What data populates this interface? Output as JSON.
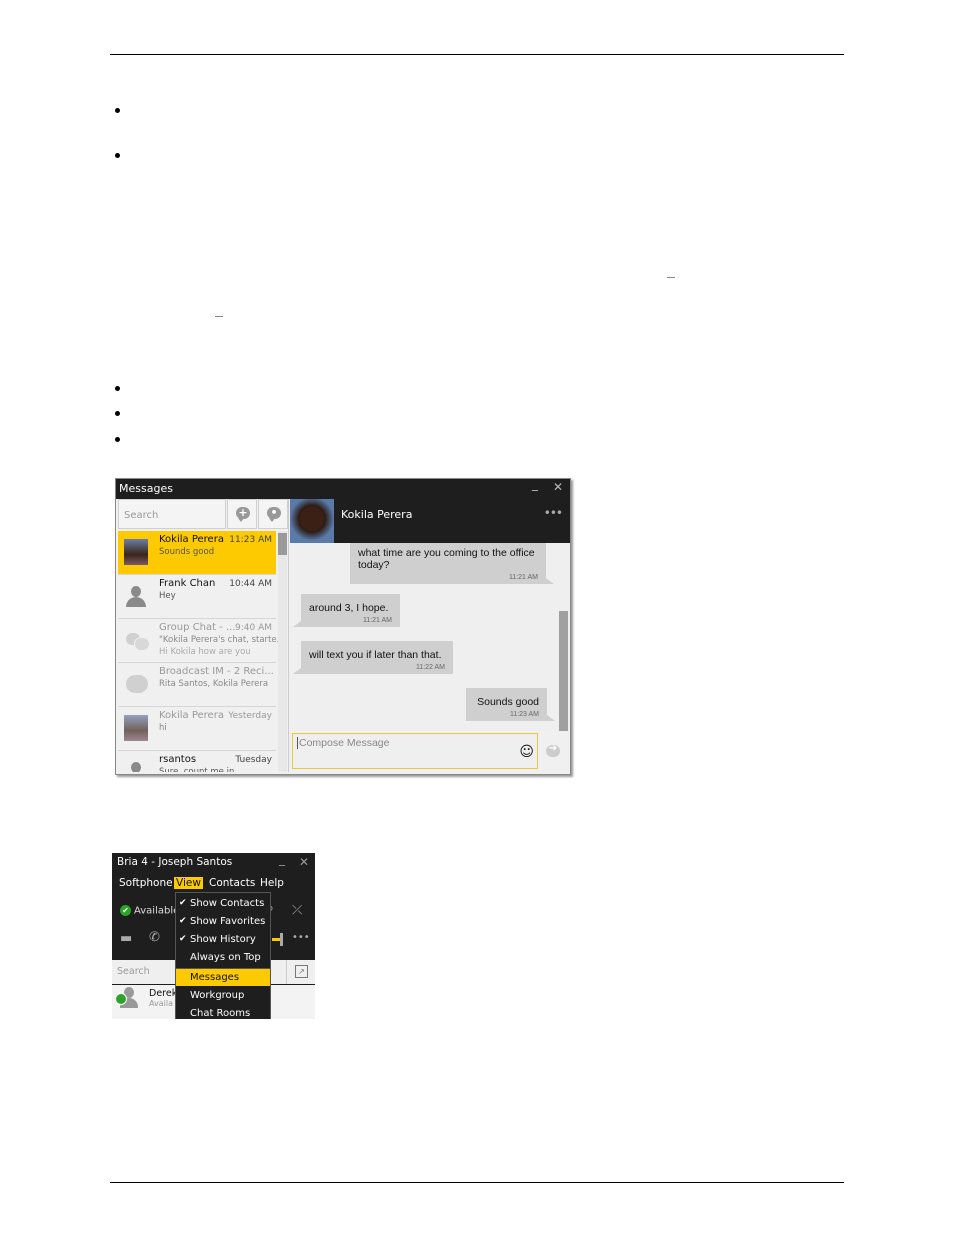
{
  "document": {
    "header_rule": true,
    "footer_rule": true,
    "bullet_groups": [
      2,
      3
    ]
  },
  "messages_window": {
    "title": "Messages",
    "search_placeholder": "Search",
    "new_message_icon": "new-message-icon",
    "new_group_icon": "new-group-message-icon",
    "conversations": [
      {
        "name": "Kokila Perera",
        "time": "11:23 AM",
        "preview": "Sounds good",
        "avatar": "photo",
        "selected": true
      },
      {
        "name": "Frank Chan",
        "time": "10:44 AM",
        "preview": "Hey",
        "avatar": "person"
      },
      {
        "name": "Group Chat - ...",
        "time": "9:40 AM",
        "preview": "\"Kokila Perera's chat, starte...",
        "preview2": "Hi Kokila how are you",
        "avatar": "group",
        "dim": true
      },
      {
        "name": "Broadcast IM - 2 Reci...",
        "time": "",
        "preview": "Rita Santos, Kokila Perera",
        "avatar": "broadcast",
        "dim": true
      },
      {
        "name": "Kokila Perera",
        "time": "Yesterday",
        "preview": "hi",
        "avatar": "photo",
        "dim": true
      },
      {
        "name": "rsantos",
        "time": "Tuesday",
        "preview": "Sure, count me in",
        "avatar": "person"
      }
    ],
    "chat": {
      "contact_name": "Kokila Perera",
      "more_label": "•••",
      "messages": [
        {
          "text": "what time are you coming to the office today?",
          "time": "11:21 AM",
          "direction": "out"
        },
        {
          "text": "around 3, I hope.",
          "time": "11:21 AM",
          "direction": "in"
        },
        {
          "text": "will text you if later than that.",
          "time": "11:22 AM",
          "direction": "in"
        },
        {
          "text": "Sounds good",
          "time": "11:23 AM",
          "direction": "out"
        }
      ],
      "compose_placeholder": "Compose Message",
      "emoji_glyph": "☺",
      "send_glyph": "➔"
    },
    "minimize_glyph": "_",
    "close_glyph": "✕"
  },
  "bria_window": {
    "title": "Bria 4 - Joseph Santos",
    "menu": [
      "Softphone",
      "View",
      "Contacts",
      "Help"
    ],
    "active_menu": "View",
    "status": "Available",
    "search_placeholder": "Search",
    "contact": {
      "name": "Derek",
      "status": "Availa"
    },
    "view_menu": [
      {
        "label": "Show Contacts",
        "checked": true
      },
      {
        "label": "Show Favorites",
        "checked": true
      },
      {
        "label": "Show History",
        "checked": true
      },
      {
        "label": "Always on Top",
        "checked": false
      },
      {
        "label": "Messages",
        "checked": false,
        "highlighted": true
      },
      {
        "label": "Workgroup",
        "checked": false
      },
      {
        "label": "Chat Rooms",
        "checked": false
      }
    ],
    "check_glyph": "✔",
    "more_label": "•••",
    "minimize_glyph": "_",
    "close_glyph": "✕"
  },
  "colors": {
    "accent": "#fdc900",
    "dark": "#1e1e1e",
    "available": "#2aa52a"
  }
}
